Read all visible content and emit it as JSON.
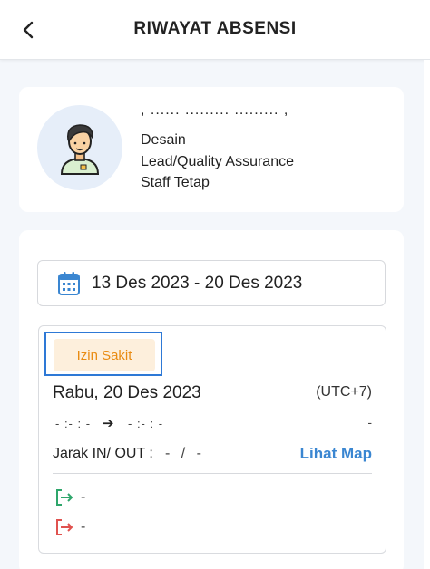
{
  "header": {
    "title": "RIWAYAT ABSENSI",
    "back_icon": "chevron-left-icon"
  },
  "profile": {
    "name": ", ...... ......... ......... ,",
    "department": "Desain",
    "position": "Lead/Quality Assurance",
    "employment_status": "Staff Tetap",
    "avatar_icon": "person-avatar-icon"
  },
  "filter": {
    "date_range": "13 Des 2023 - 20 Des 2023",
    "calendar_icon": "calendar-icon"
  },
  "attendance": {
    "status": "Izin Sakit",
    "day": "Rabu, 20 Des 2023",
    "timezone": "(UTC+7)",
    "time_in": "- :- : -",
    "arrow": "➔",
    "time_out": "- :- : -",
    "duration": "-",
    "distance_label": "Jarak IN/ OUT :",
    "distance_value": "- / -",
    "map_link": "Lihat Map",
    "check_in_value": "-",
    "check_out_value": "-"
  },
  "colors": {
    "accent_blue": "#3a86d1",
    "status_orange": "#e98b12",
    "status_bg": "#fdefdc",
    "highlight": "#2e79d6",
    "check_in_green": "#2ea66b",
    "check_out_red": "#e0524f"
  }
}
